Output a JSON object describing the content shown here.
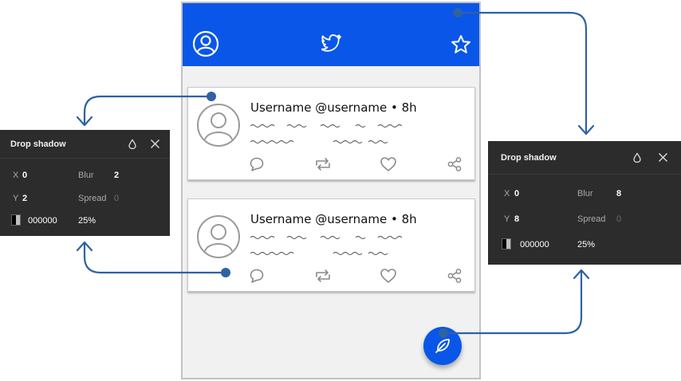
{
  "colors": {
    "accent": "#0a56e8",
    "connector": "#2e62a3",
    "panel_bg": "#2c2c2c",
    "phone_bg": "#f1f1f1"
  },
  "app": {
    "header_icons": [
      "profile-icon",
      "twitter-bird-icon",
      "star-icon"
    ],
    "fab_icon": "feather-icon"
  },
  "tweets": [
    {
      "title": "Username @username • 8h",
      "actions": [
        "reply-icon",
        "retweet-icon",
        "heart-icon",
        "share-icon"
      ]
    },
    {
      "title": "Username @username • 8h",
      "actions": [
        "reply-icon",
        "retweet-icon",
        "heart-icon",
        "share-icon"
      ]
    }
  ],
  "panel_left": {
    "title": "Drop shadow",
    "x_label": "X",
    "x_value": "0",
    "y_label": "Y",
    "y_value": "2",
    "blur_label": "Blur",
    "blur_value": "2",
    "spread_label": "Spread",
    "spread_value": "0",
    "color": "000000",
    "opacity": "25%"
  },
  "panel_right": {
    "title": "Drop shadow",
    "x_label": "X",
    "x_value": "0",
    "y_label": "Y",
    "y_value": "8",
    "blur_label": "Blur",
    "blur_value": "8",
    "spread_label": "Spread",
    "spread_value": "0",
    "color": "000000",
    "opacity": "25%"
  }
}
